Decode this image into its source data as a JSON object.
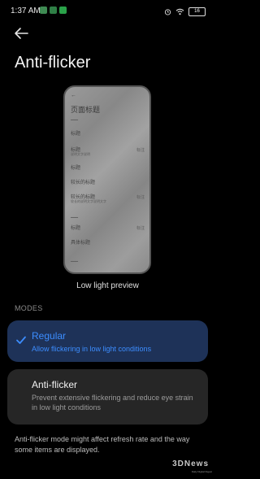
{
  "status_bar": {
    "time": "1:37 AM",
    "battery": "16"
  },
  "page": {
    "title": "Anti-flicker",
    "preview_caption": "Low light preview",
    "section_header": "MODES"
  },
  "preview": {
    "title": "页面标题",
    "items": [
      {
        "label": "标题"
      },
      {
        "label": "标题",
        "sub": "说明文字说明",
        "right": "标注"
      },
      {
        "label": "标题"
      },
      {
        "label": "较长的标题"
      },
      {
        "label": "较长的标题",
        "sub": "较长的说明文字说明文字",
        "right": "标注"
      },
      {
        "label": "标题",
        "right": "标注"
      },
      {
        "label": "具体标题"
      }
    ]
  },
  "modes": [
    {
      "title": "Regular",
      "description": "Allow flickering in low light conditions",
      "selected": true
    },
    {
      "title": "Anti-flicker",
      "description": "Prevent extensive flickering and reduce eye strain in low light conditions",
      "selected": false
    }
  ],
  "footnote": "Anti-flicker mode might affect refresh rate and the way some items are displayed.",
  "watermark": {
    "logo": "3DNews",
    "tagline": "Daily Digital Digest"
  },
  "colors": {
    "accent": "#3c8dff",
    "selected_card": "#1e3258",
    "card": "#262626",
    "background": "#000000"
  }
}
